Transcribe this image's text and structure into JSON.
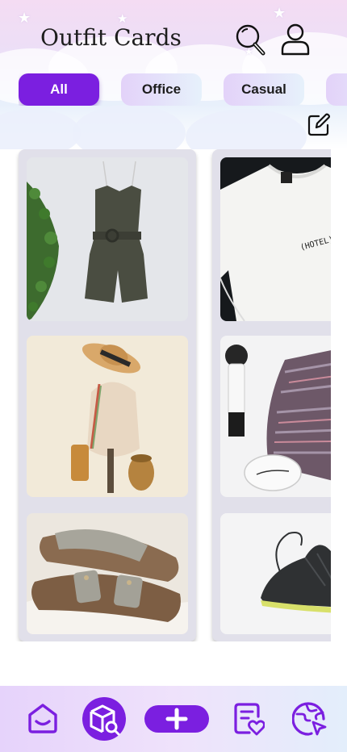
{
  "header": {
    "title": "Outfit Cards"
  },
  "filters": [
    {
      "label": "All",
      "active": true
    },
    {
      "label": "Office",
      "active": false
    },
    {
      "label": "Casual",
      "active": false
    }
  ],
  "colors": {
    "accent": "#7b1fe0",
    "column_bg": "#e1e0ea",
    "chip_inactive": "#e3d2f9"
  },
  "icons": {
    "search": "search-icon",
    "profile": "user-icon",
    "edit": "edit-icon",
    "nav": [
      "home-icon",
      "box-search-icon",
      "plus-icon",
      "notes-heart-icon",
      "globe-cursor-icon"
    ]
  }
}
